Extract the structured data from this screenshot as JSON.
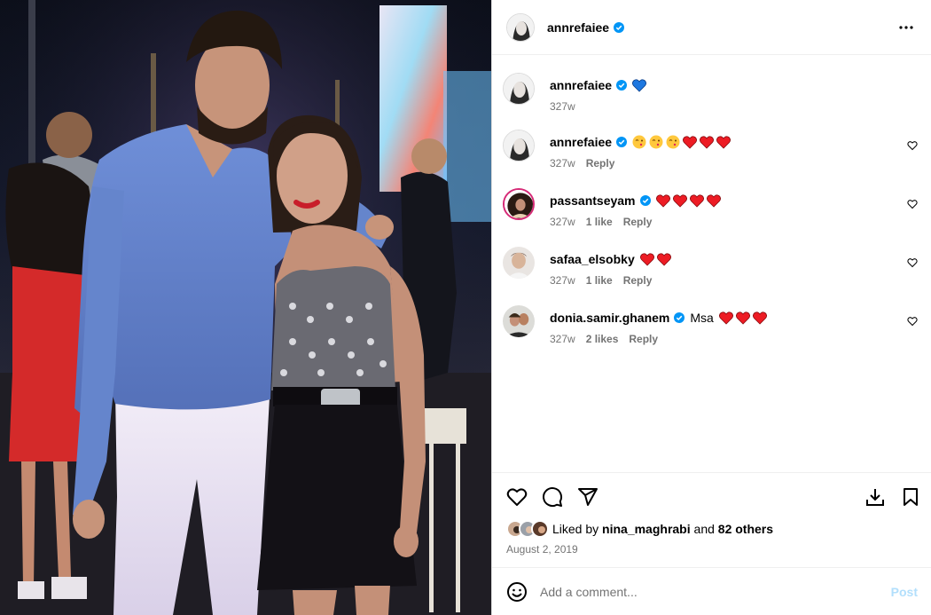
{
  "header": {
    "username": "annrefaiee",
    "more_label": "More options"
  },
  "caption": {
    "username": "annrefaiee",
    "text_emoji": "blue-heart",
    "time": "327w"
  },
  "comments": [
    {
      "username": "annrefaiee",
      "verified": true,
      "text": "",
      "emojis": [
        "wink-kiss",
        "wink-kiss",
        "wink-kiss",
        "red-heart",
        "red-heart",
        "red-heart"
      ],
      "time": "327w",
      "likes": "",
      "reply": "Reply"
    },
    {
      "username": "passantseyam",
      "verified": true,
      "text": "",
      "emojis": [
        "red-heart",
        "red-heart",
        "red-heart",
        "red-heart"
      ],
      "time": "327w",
      "likes": "1 like",
      "reply": "Reply"
    },
    {
      "username": "safaa_elsobky",
      "verified": false,
      "text": "",
      "emojis": [
        "red-heart",
        "red-heart"
      ],
      "time": "327w",
      "likes": "1 like",
      "reply": "Reply"
    },
    {
      "username": "donia.samir.ghanem",
      "verified": true,
      "text": "Msa",
      "emojis": [
        "red-heart",
        "red-heart",
        "red-heart"
      ],
      "time": "327w",
      "likes": "2 likes",
      "reply": "Reply"
    }
  ],
  "likes": {
    "prefix": "Liked by",
    "user": "nina_maghrabi",
    "middle": "and",
    "others": "82 others"
  },
  "date": "August 2, 2019",
  "add_comment": {
    "placeholder": "Add a comment...",
    "post_label": "Post"
  },
  "colors": {
    "verified": "#0095f6",
    "heart": "#ed1c24",
    "post_disabled": "#b2dffc",
    "muted": "#737373"
  }
}
